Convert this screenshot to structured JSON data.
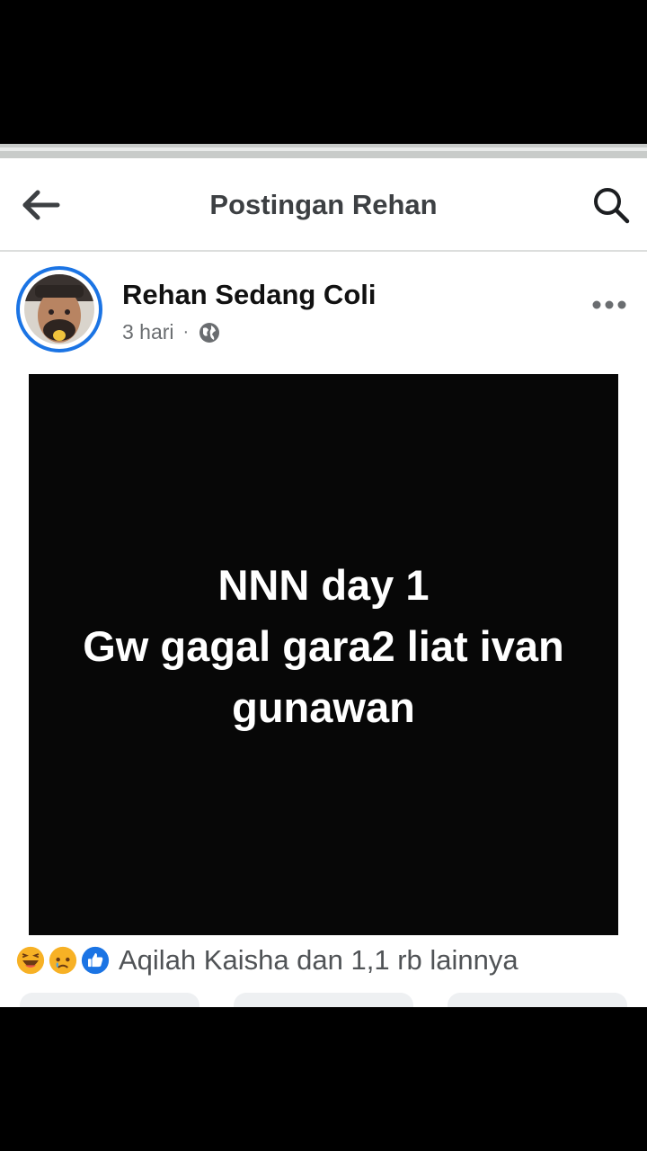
{
  "header": {
    "title": "Postingan Rehan",
    "back_icon": "arrow-left-icon",
    "search_icon": "search-icon"
  },
  "post": {
    "author": "Rehan Sedang Coli",
    "time": "3 hari",
    "separator": "·",
    "privacy_icon": "globe-icon",
    "more_icon": "more-horizontal-icon",
    "media_text_lines": [
      "NNN day 1",
      "Gw gagal gara2 liat ivan",
      "gunawan"
    ]
  },
  "reactions": {
    "icons": [
      "haha-icon",
      "sad-icon",
      "like-icon"
    ],
    "summary": "Aqilah Kaisha dan 1,1 rb lainnya"
  },
  "colors": {
    "accent": "#1b74e4",
    "title_text": "#3d4043",
    "meta_text": "#6a6d70",
    "media_bg": "#070707"
  }
}
